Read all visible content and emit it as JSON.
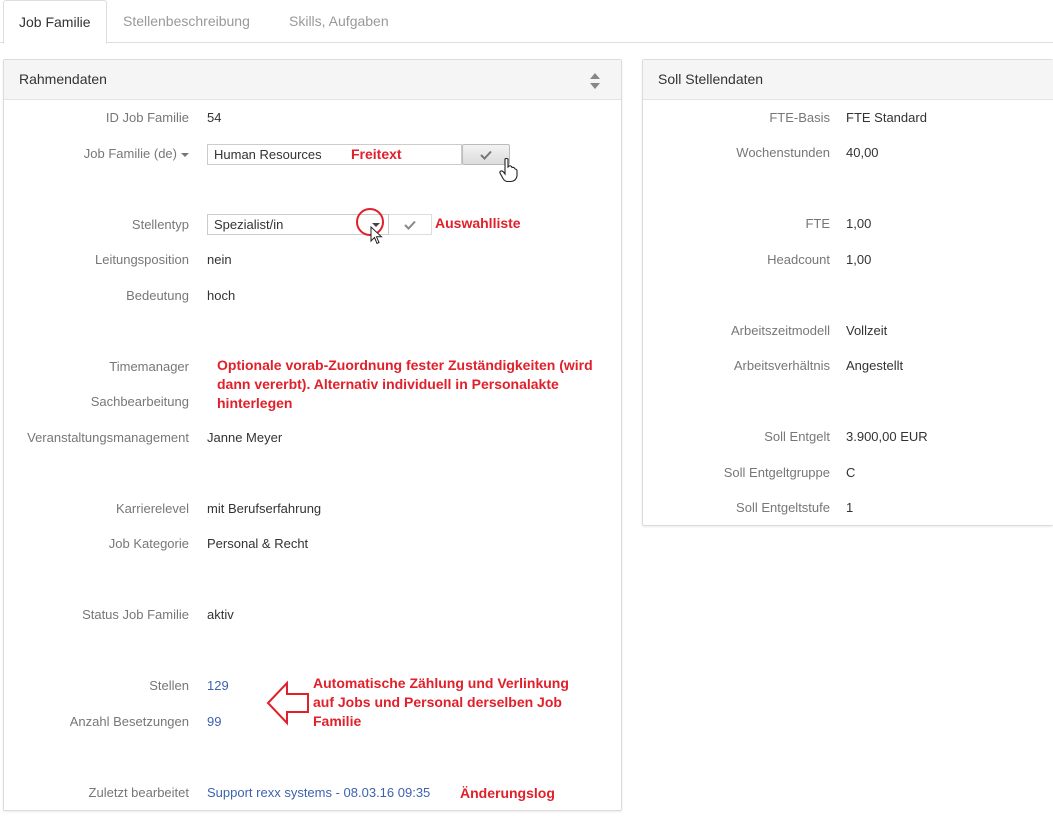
{
  "tabs": [
    {
      "label": "Job Familie"
    },
    {
      "label": "Stellenbeschreibung"
    },
    {
      "label": "Skills, Aufgaben"
    }
  ],
  "left_panel": {
    "title": "Rahmendaten",
    "fields": {
      "id_job_familie": {
        "label": "ID Job Familie",
        "value": "54"
      },
      "job_familie": {
        "label": "Job Familie (de)",
        "value": "Human Resources"
      },
      "stellentyp": {
        "label": "Stellentyp",
        "value": "Spezialist/in"
      },
      "leitungsposition": {
        "label": "Leitungsposition",
        "value": "nein"
      },
      "bedeutung": {
        "label": "Bedeutung",
        "value": "hoch"
      },
      "timemanager": {
        "label": "Timemanager",
        "value": ""
      },
      "sachbearbeitung": {
        "label": "Sachbearbeitung",
        "value": ""
      },
      "veranstaltungsmanagement": {
        "label": "Veranstaltungsmanagement",
        "value": "Janne Meyer"
      },
      "karrierelevel": {
        "label": "Karrierelevel",
        "value": "mit Berufserfahrung"
      },
      "job_kategorie": {
        "label": "Job Kategorie",
        "value": "Personal & Recht"
      },
      "status": {
        "label": "Status Job Familie",
        "value": "aktiv"
      },
      "stellen": {
        "label": "Stellen",
        "value": "129"
      },
      "anzahl_besetzungen": {
        "label": "Anzahl Besetzungen",
        "value": "99"
      },
      "zuletzt_bearbeitet": {
        "label": "Zuletzt bearbeitet",
        "value": "Support rexx systems - 08.03.16 09:35"
      }
    }
  },
  "right_panel": {
    "title": "Soll Stellendaten",
    "fields": {
      "fte_basis": {
        "label": "FTE-Basis",
        "value": "FTE Standard"
      },
      "wochenstunden": {
        "label": "Wochenstunden",
        "value": "40,00"
      },
      "fte": {
        "label": "FTE",
        "value": "1,00"
      },
      "headcount": {
        "label": "Headcount",
        "value": "1,00"
      },
      "arbeitszeitmodell": {
        "label": "Arbeitszeitmodell",
        "value": "Vollzeit"
      },
      "arbeitsverhaeltnis": {
        "label": "Arbeitsverhältnis",
        "value": "Angestellt"
      },
      "soll_entgelt": {
        "label": "Soll Entgelt",
        "value": "3.900,00 EUR"
      },
      "soll_entgeltgruppe": {
        "label": "Soll Entgeltgruppe",
        "value": "C"
      },
      "soll_entgeltstufe": {
        "label": "Soll Entgeltstufe",
        "value": "1"
      }
    }
  },
  "annotations": {
    "freitext": "Freitext",
    "auswahlliste": "Auswahlliste",
    "optionale_line1": "Optionale vorab-Zuordnung fester Zuständigkeiten (wird",
    "optionale_line2": "dann vererbt). Alternativ individuell in Personalakte",
    "optionale_line3": "hinterlegen",
    "automatische_line1": "Automatische Zählung und Verlinkung",
    "automatische_line2": "auf Jobs und Personal derselben Job",
    "automatische_line3": "Familie",
    "aenderungslog": "Änderungslog"
  },
  "colors": {
    "annotation": "#e0202a",
    "link": "#3d62b0"
  }
}
